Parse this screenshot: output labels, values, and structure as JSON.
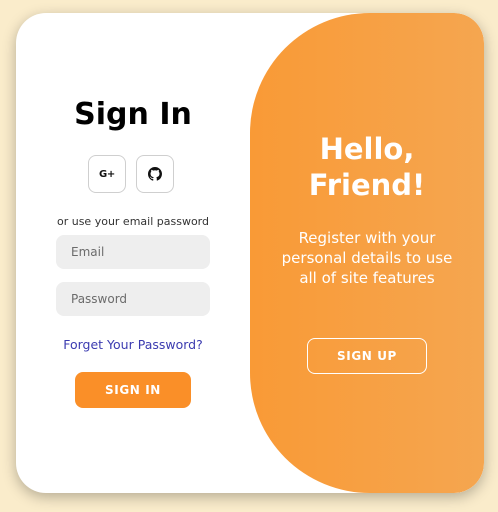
{
  "sign_in": {
    "title": "Sign In",
    "social": [
      {
        "icon": "google-plus-icon",
        "label": "G+"
      },
      {
        "icon": "github-icon",
        "label": ""
      }
    ],
    "subtitle": "or use your email password",
    "email_placeholder": "Email",
    "password_placeholder": "Password",
    "forgot_link": "Forget Your Password?",
    "button_label": "SIGN IN"
  },
  "overlay": {
    "title_line1": "Hello,",
    "title_line2": "Friend!",
    "text": "Register with your personal details to use all of site features",
    "button_label": "SIGN UP"
  },
  "colors": {
    "background": "#faeccb",
    "accent": "#fa8f28",
    "overlay": "#f7a043",
    "link": "#3b3bb0"
  }
}
